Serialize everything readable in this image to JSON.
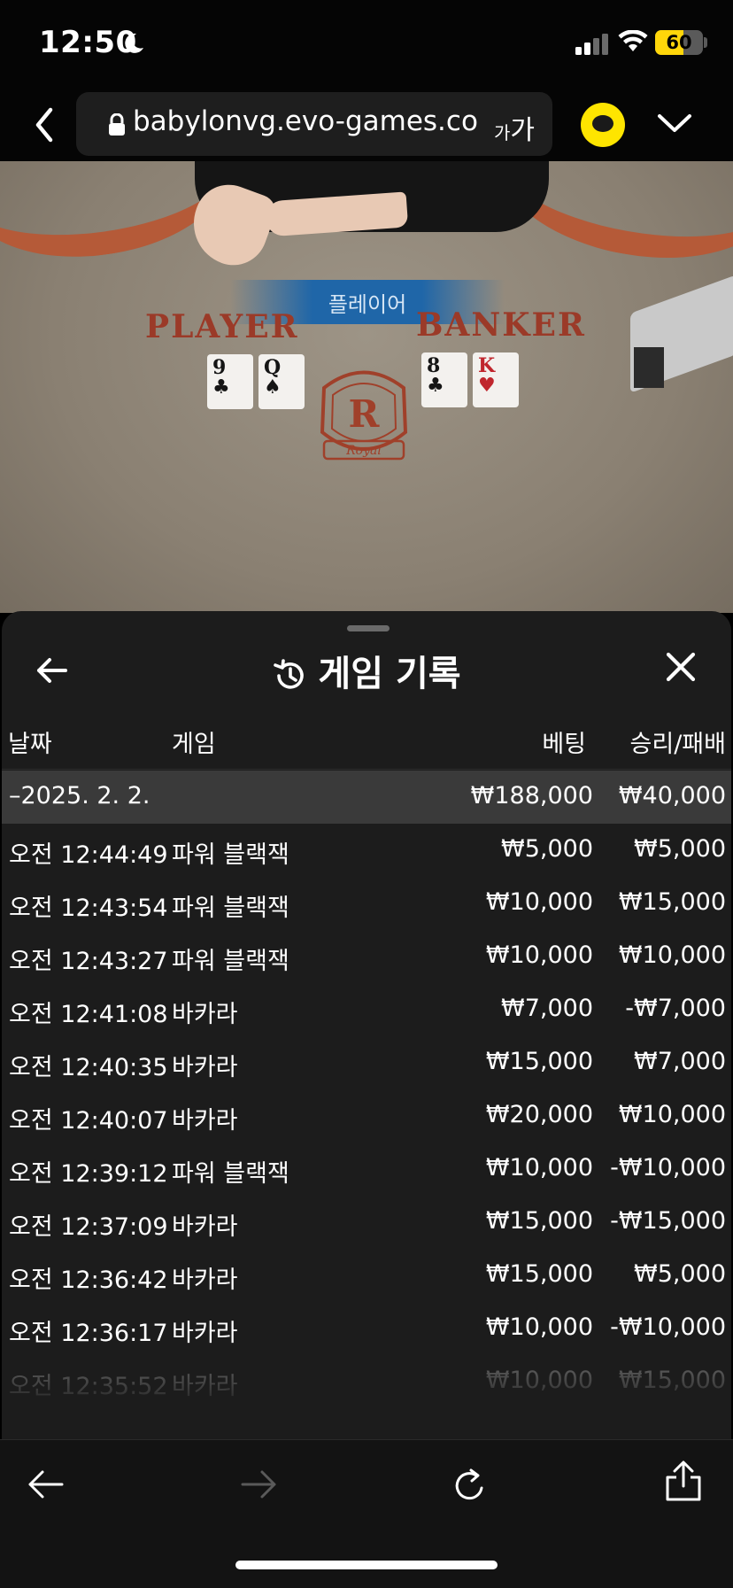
{
  "status_bar": {
    "time": "12:50",
    "battery": "60",
    "battery_level": 0.6
  },
  "browser": {
    "url": "babylonvg.evo-games.com",
    "text_size_small": "가",
    "text_size_large": "가"
  },
  "game": {
    "result_banner": "플레이어",
    "player_label": "PLAYER",
    "banker_label": "BANKER",
    "seal_letter": "R",
    "seal_text": "Royal",
    "cards": [
      {
        "rank": "9",
        "suit": "♣",
        "color": "black"
      },
      {
        "rank": "Q",
        "suit": "♠",
        "color": "black"
      },
      {
        "rank": "8",
        "suit": "♣",
        "color": "black"
      },
      {
        "rank": "K",
        "suit": "♥",
        "color": "red"
      }
    ]
  },
  "history": {
    "title": "게임 기록",
    "columns": {
      "date": "날짜",
      "game": "게임",
      "bet": "베팅",
      "result": "승리/패배"
    },
    "date_row": {
      "date": "–2025. 2. 2.",
      "bet": "₩188,000",
      "result": "₩40,000"
    },
    "rows": [
      {
        "time": "오전 12:44:49",
        "game": "파워 블랙잭",
        "bet": "₩5,000",
        "result": "₩5,000"
      },
      {
        "time": "오전 12:43:54",
        "game": "파워 블랙잭",
        "bet": "₩10,000",
        "result": "₩15,000"
      },
      {
        "time": "오전 12:43:27",
        "game": "파워 블랙잭",
        "bet": "₩10,000",
        "result": "₩10,000"
      },
      {
        "time": "오전 12:41:08",
        "game": "바카라",
        "bet": "₩7,000",
        "result": "-₩7,000"
      },
      {
        "time": "오전 12:40:35",
        "game": "바카라",
        "bet": "₩15,000",
        "result": "₩7,000"
      },
      {
        "time": "오전 12:40:07",
        "game": "바카라",
        "bet": "₩20,000",
        "result": "₩10,000"
      },
      {
        "time": "오전 12:39:12",
        "game": "파워 블랙잭",
        "bet": "₩10,000",
        "result": "-₩10,000"
      },
      {
        "time": "오전 12:37:09",
        "game": "바카라",
        "bet": "₩15,000",
        "result": "-₩15,000"
      },
      {
        "time": "오전 12:36:42",
        "game": "바카라",
        "bet": "₩15,000",
        "result": "₩5,000"
      },
      {
        "time": "오전 12:36:17",
        "game": "바카라",
        "bet": "₩10,000",
        "result": "-₩10,000"
      },
      {
        "time": "오전 12:35:52",
        "game": "바카라",
        "bet": "₩10,000",
        "result": "₩15,000"
      }
    ]
  },
  "icons": {
    "moon": "moon-icon",
    "signal": "cellular-signal-icon",
    "wifi": "wifi-icon",
    "lock": "lock-icon",
    "kakao": "kakaotalk-icon",
    "history": "history-clock-icon",
    "close": "close-icon",
    "back": "arrow-left-icon",
    "forward": "arrow-right-icon",
    "reload": "reload-icon",
    "share": "share-icon"
  },
  "colors": {
    "panel_bg": "#1c1c1c",
    "date_row_bg": "#3a3a3a",
    "battery": "#ffd60a",
    "kakao": "#fee500",
    "banner": "#1f66a8"
  }
}
